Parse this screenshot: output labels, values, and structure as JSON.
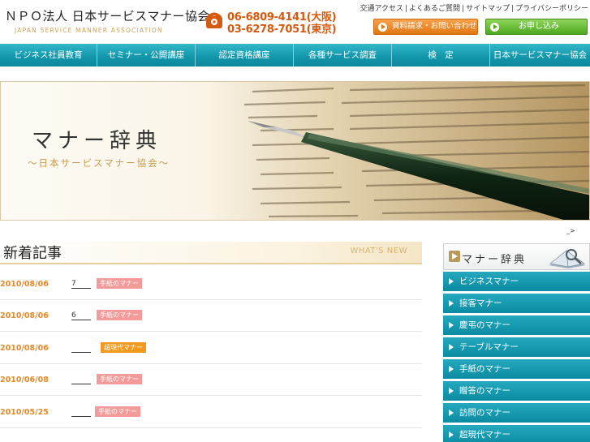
{
  "header": {
    "org_title": "ＮＰＯ法人 日本サービスマナー協会",
    "org_sub": "JAPAN SERVICE MANNER ASSOCIATION",
    "phone_osaka": "06-6809-4141(大阪)",
    "phone_tokyo": "03-6278-7051(東京)",
    "top_links": [
      "交通アクセス",
      "よくあるご質問",
      "サイトマップ",
      "プライバシーポリシー"
    ],
    "request_button": "資料請求・お問い合わせ",
    "apply_button": "お申し込み",
    "accent_orange": "#e07712",
    "accent_green": "#4ea81e"
  },
  "nav": {
    "items": [
      "ビジネス社員教育",
      "セミナー・公開講座",
      "認定資格講座",
      "各種サービス調査",
      "検　定",
      "日本サービスマナー協会"
    ],
    "color": "#1398ad"
  },
  "banner": {
    "title": "マナー辞典",
    "subtitle": "〜日本サービスマナー協会〜"
  },
  "small_link": "_>",
  "news": {
    "title": "新着記事",
    "eng": "WHAT'S NEW",
    "rows": [
      {
        "date": "2010/08/06",
        "text": "7",
        "tag": "手紙のマナー",
        "tag_color": "pink"
      },
      {
        "date": "2010/08/06",
        "text": "6",
        "tag": "手紙のマナー",
        "tag_color": "pink"
      },
      {
        "date": "2010/08/06",
        "text": "",
        "tag": "超現代マナー",
        "tag_color": "orange"
      },
      {
        "date": "2010/06/08",
        "text": "",
        "tag": "手紙のマナー",
        "tag_color": "pink"
      },
      {
        "date": "2010/05/25",
        "text": "",
        "tag": "手紙のマナー",
        "tag_color": "pink"
      }
    ]
  },
  "sidebar": {
    "title": "マナー辞典",
    "items": [
      "ビジネスマナー",
      "接客マナー",
      "慶弔のマナー",
      "テーブルマナー",
      "手紙のマナー",
      "贈答のマナー",
      "訪問のマナー",
      "超現代マナー"
    ]
  }
}
